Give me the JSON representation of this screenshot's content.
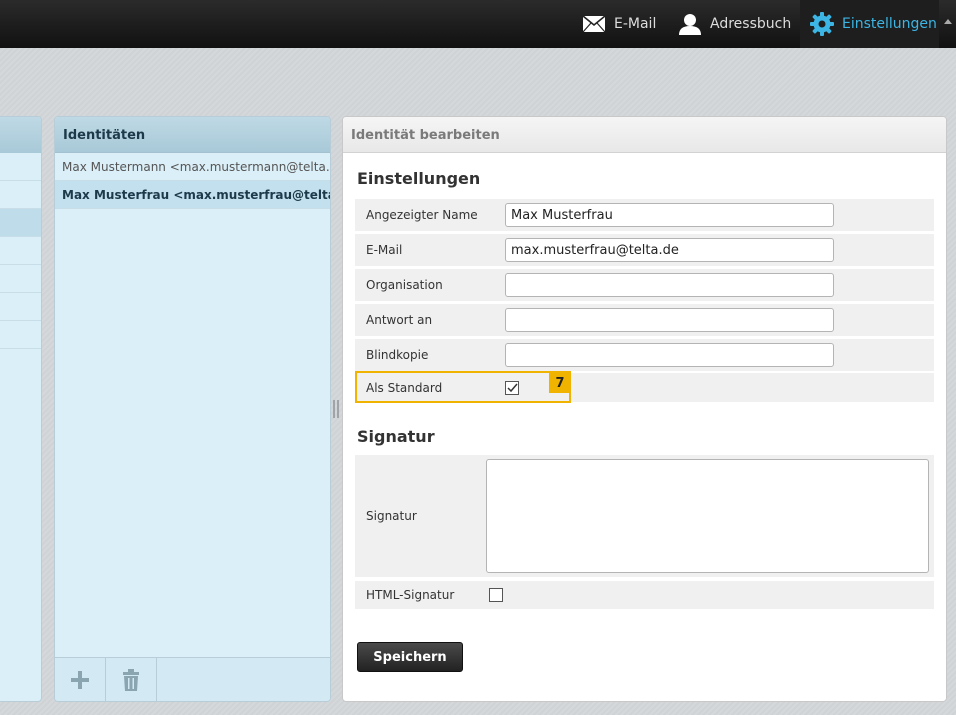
{
  "topnav": {
    "email": "E-Mail",
    "addressbook": "Adressbuch",
    "settings": "Einstellungen"
  },
  "identities": {
    "title": "Identitäten",
    "items": [
      "Max Mustermann <max.mustermann@telta.de>",
      "Max Musterfrau <max.musterfrau@telta.de>"
    ],
    "selected_index": 1
  },
  "edit": {
    "title": "Identität bearbeiten",
    "settings_section": "Einstellungen",
    "fields": {
      "name_label": "Angezeigter Name",
      "name_value": "Max Musterfrau",
      "email_label": "E-Mail",
      "email_value": "max.musterfrau@telta.de",
      "org_label": "Organisation",
      "org_value": "",
      "reply_label": "Antwort an",
      "reply_value": "",
      "bcc_label": "Blindkopie",
      "bcc_value": "",
      "default_label": "Als Standard",
      "default_checked": true
    },
    "step_badge": "7",
    "signature_section": "Signatur",
    "signature_label": "Signatur",
    "signature_value": "",
    "html_sig_label": "HTML-Signatur",
    "html_sig_checked": false,
    "save_label": "Speichern"
  },
  "colors": {
    "accent": "#3cb5e4",
    "highlight": "#f0b400"
  }
}
